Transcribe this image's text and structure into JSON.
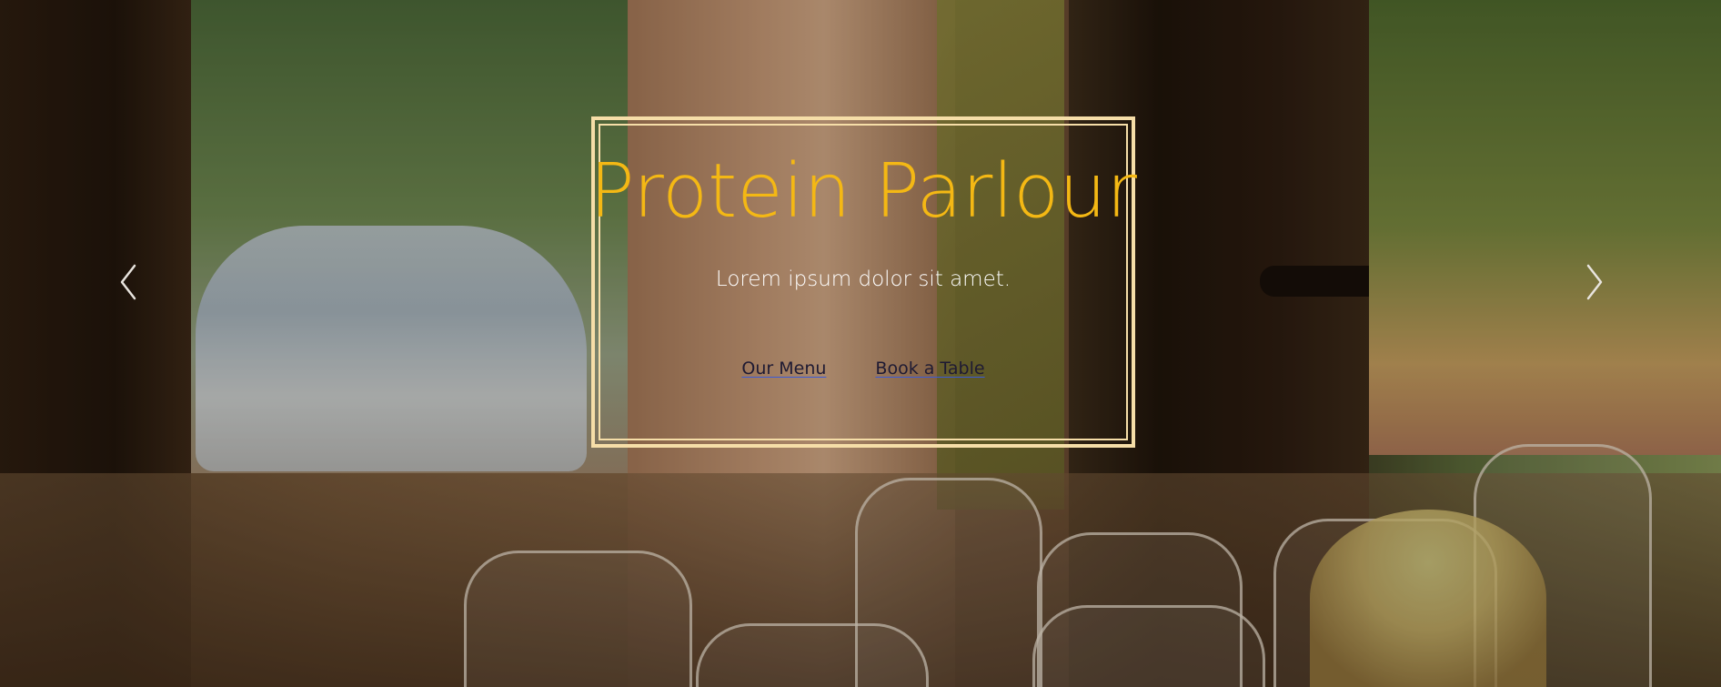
{
  "hero": {
    "title": "Protein Parlour",
    "subtitle": "Lorem ipsum dolor sit amet.",
    "links": {
      "menu": "Our Menu",
      "book": "Book a Table"
    }
  },
  "carousel": {
    "prev_icon": "chevron-left-icon",
    "next_icon": "chevron-right-icon"
  },
  "colors": {
    "title": "#f4b814",
    "border": "#f6dea8",
    "subtitle": "#ffffff"
  }
}
